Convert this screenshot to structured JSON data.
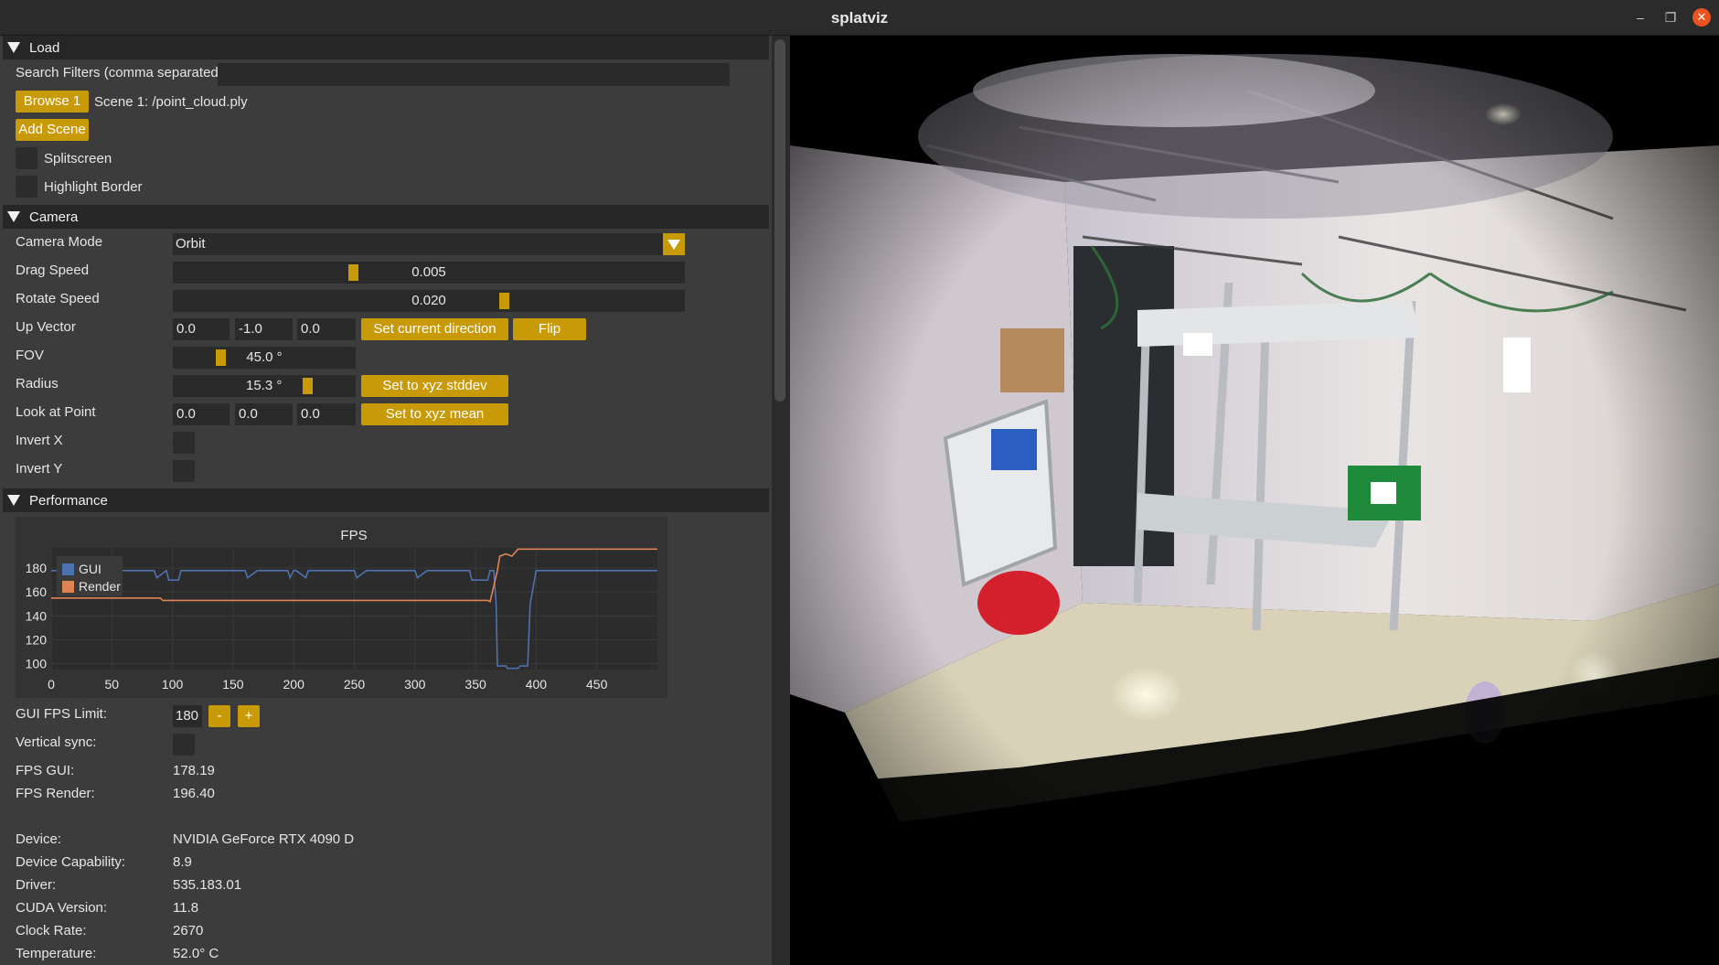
{
  "window": {
    "title": "splatviz",
    "minimize_icon": "minimize-icon",
    "maximize_icon": "maximize-icon",
    "close_icon": "close-icon"
  },
  "load": {
    "header": "Load",
    "search_label": "Search Filters (comma separated)",
    "search_value": "",
    "browse_label": "Browse 1",
    "scene_text": "Scene 1: /point_cloud.ply",
    "add_scene_label": "Add Scene",
    "splitscreen_label": "Splitscreen",
    "highlight_border_label": "Highlight Border"
  },
  "camera": {
    "header": "Camera",
    "mode_label": "Camera Mode",
    "mode_value": "Orbit",
    "drag_speed_label": "Drag Speed",
    "drag_speed_value": "0.005",
    "drag_speed_fraction": 0.35,
    "rotate_speed_label": "Rotate Speed",
    "rotate_speed_value": "0.020",
    "rotate_speed_fraction": 0.65,
    "up_vector_label": "Up Vector",
    "up_vector": [
      "0.0",
      "-1.0",
      "0.0"
    ],
    "set_current_direction_label": "Set current direction",
    "flip_label": "Flip",
    "fov_label": "FOV",
    "fov_value": "45.0 °",
    "fov_fraction": 0.25,
    "radius_label": "Radius",
    "radius_value": "15.3 °",
    "radius_fraction": 0.75,
    "set_xyz_stddev_label": "Set to xyz stddev",
    "look_at_label": "Look at Point",
    "look_at": [
      "0.0",
      "0.0",
      "0.0"
    ],
    "set_xyz_mean_label": "Set to xyz mean",
    "invert_x_label": "Invert X",
    "invert_y_label": "Invert Y"
  },
  "performance": {
    "header": "Performance",
    "gui_fps_limit_label": "GUI FPS Limit:",
    "gui_fps_limit_value": "180",
    "minus_label": "-",
    "plus_label": "+",
    "vsync_label": "Vertical sync:",
    "fps_gui_label": "FPS GUI:",
    "fps_gui_value": "178.19",
    "fps_render_label": "FPS Render:",
    "fps_render_value": "196.40",
    "device_label": "Device:",
    "device_value": "NVIDIA GeForce RTX 4090 D",
    "capability_label": "Device Capability:",
    "capability_value": "8.9",
    "driver_label": "Driver:",
    "driver_value": "535.183.01",
    "cuda_label": "CUDA Version:",
    "cuda_value": "11.8",
    "clock_label": "Clock Rate:",
    "clock_value": "2670",
    "temp_label": "Temperature:",
    "temp_value": "52.0° C"
  },
  "colors": {
    "accent": "#c99a07",
    "gui_series": "#4c72b0",
    "render_series": "#dd8452"
  },
  "chart_data": {
    "type": "line",
    "title": "FPS",
    "xlabel": "",
    "ylabel": "",
    "xlim": [
      0,
      500
    ],
    "ylim": [
      95,
      197
    ],
    "xticks": [
      0,
      50,
      100,
      150,
      200,
      250,
      300,
      350,
      400,
      450
    ],
    "yticks": [
      100,
      120,
      140,
      160,
      180
    ],
    "legend": "top-left",
    "series": [
      {
        "name": "GUI",
        "color": "#4c72b0",
        "x": [
          0,
          40,
          42,
          44,
          85,
          87,
          95,
          97,
          105,
          107,
          110,
          160,
          162,
          170,
          172,
          195,
          197,
          200,
          202,
          210,
          212,
          250,
          252,
          260,
          262,
          300,
          302,
          310,
          312,
          345,
          347,
          360,
          362,
          365,
          367,
          368,
          375,
          376,
          385,
          387,
          393,
          395,
          400,
          402,
          500
        ],
        "y": [
          178,
          178,
          172,
          178,
          178,
          172,
          178,
          170,
          170,
          178,
          178,
          178,
          172,
          178,
          178,
          178,
          172,
          178,
          178,
          172,
          178,
          178,
          172,
          178,
          178,
          178,
          172,
          178,
          178,
          178,
          170,
          170,
          178,
          178,
          150,
          98,
          98,
          96,
          96,
          98,
          98,
          150,
          178,
          178,
          178
        ]
      },
      {
        "name": "Render",
        "color": "#dd8452",
        "x": [
          0,
          90,
          92,
          360,
          362,
          368,
          370,
          375,
          380,
          385,
          390,
          500
        ],
        "y": [
          155,
          155,
          153,
          153,
          152,
          178,
          190,
          192,
          190,
          196,
          196,
          196
        ]
      }
    ]
  }
}
